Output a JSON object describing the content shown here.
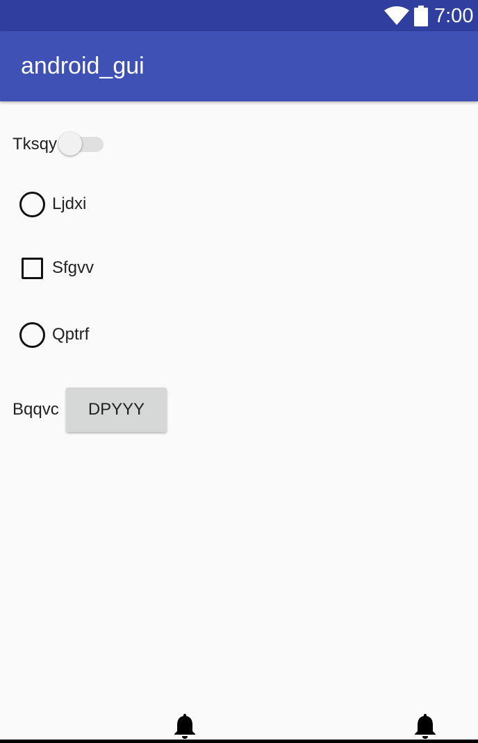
{
  "status_bar": {
    "time": "7:00",
    "icons": [
      "wifi-icon",
      "battery-icon"
    ]
  },
  "app_bar": {
    "title": "android_gui"
  },
  "form": {
    "switch": {
      "label": "Tksqy",
      "checked": false
    },
    "choices": [
      {
        "type": "radio",
        "label": "Ljdxi",
        "checked": false
      },
      {
        "type": "checkbox",
        "label": "Sfgvv",
        "checked": false
      },
      {
        "type": "radio",
        "label": "Qptrf",
        "checked": false
      }
    ],
    "button_row": {
      "label": "Bqqvc",
      "button_label": "DPYYY"
    }
  },
  "bottom_bar": {
    "icons": [
      "bell-icon",
      "bell-icon"
    ]
  },
  "colors": {
    "status_bar": "#303f9f",
    "app_bar": "#3f51b5",
    "background": "#fafafa",
    "button": "#d6d7d7"
  }
}
